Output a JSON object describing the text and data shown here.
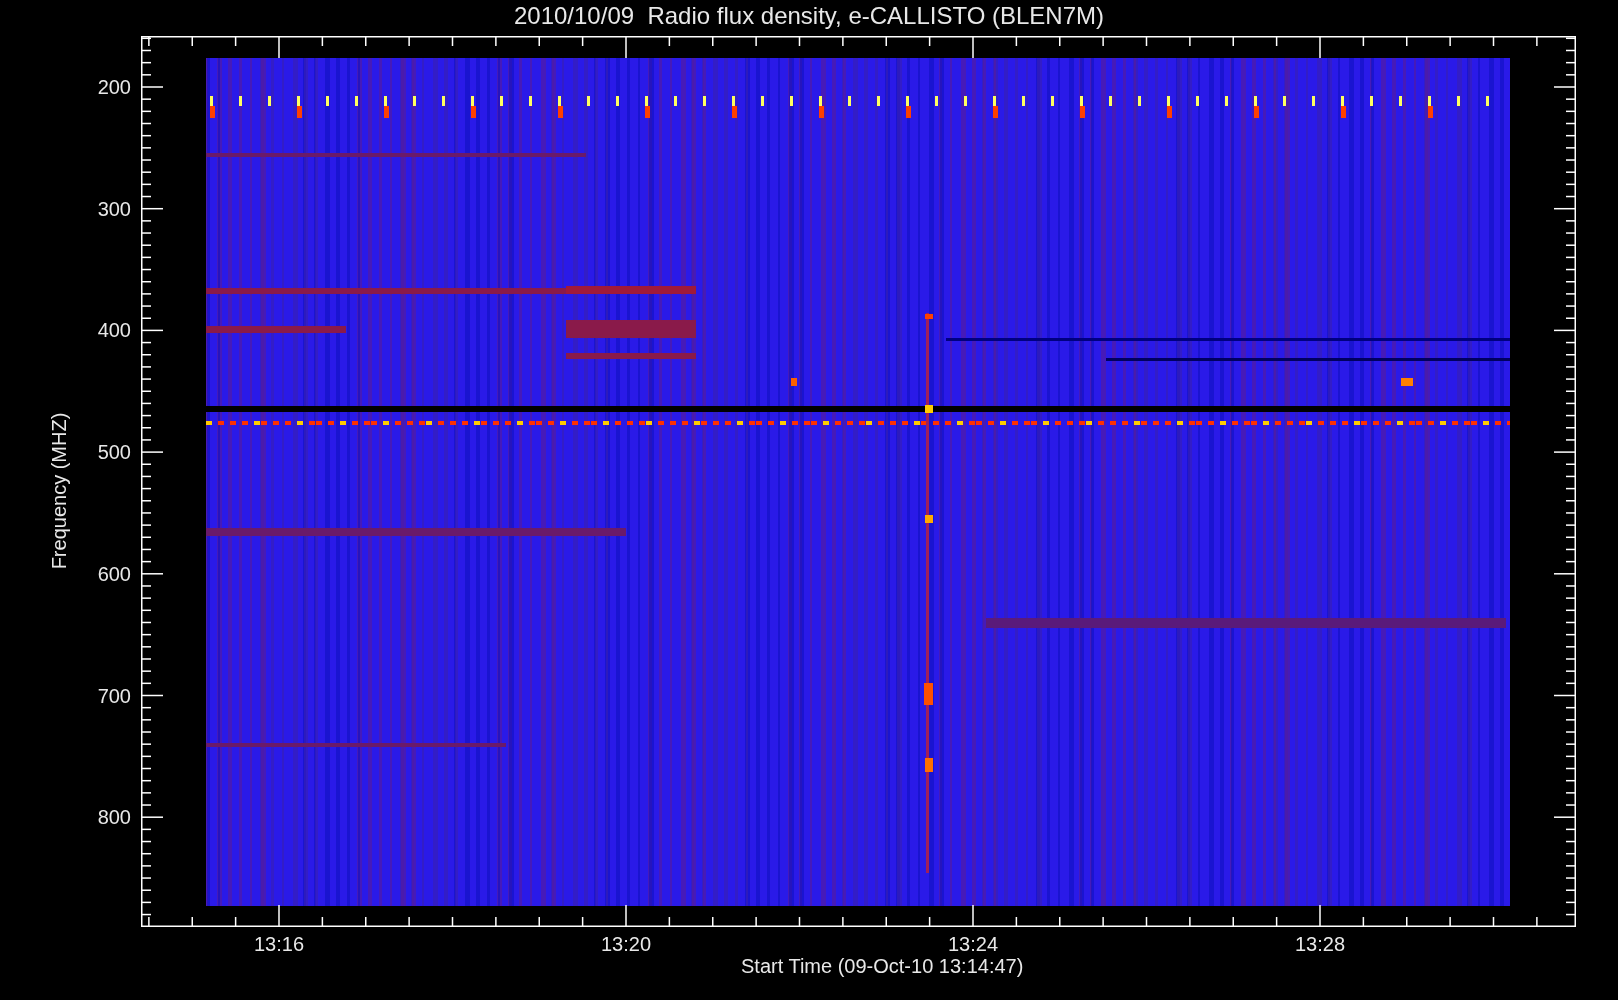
{
  "title": "2010/10/09  Radio flux density, e-CALLISTO (BLEN7M)",
  "y_axis": {
    "label": "Frequency (MHZ)",
    "ticks": [
      "200",
      "300",
      "400",
      "500",
      "600",
      "700",
      "800"
    ]
  },
  "x_axis": {
    "label": "Start Time (09-Oct-10 13:14:47)",
    "ticks": [
      "13:16",
      "13:20",
      "13:24",
      "13:28"
    ]
  }
}
